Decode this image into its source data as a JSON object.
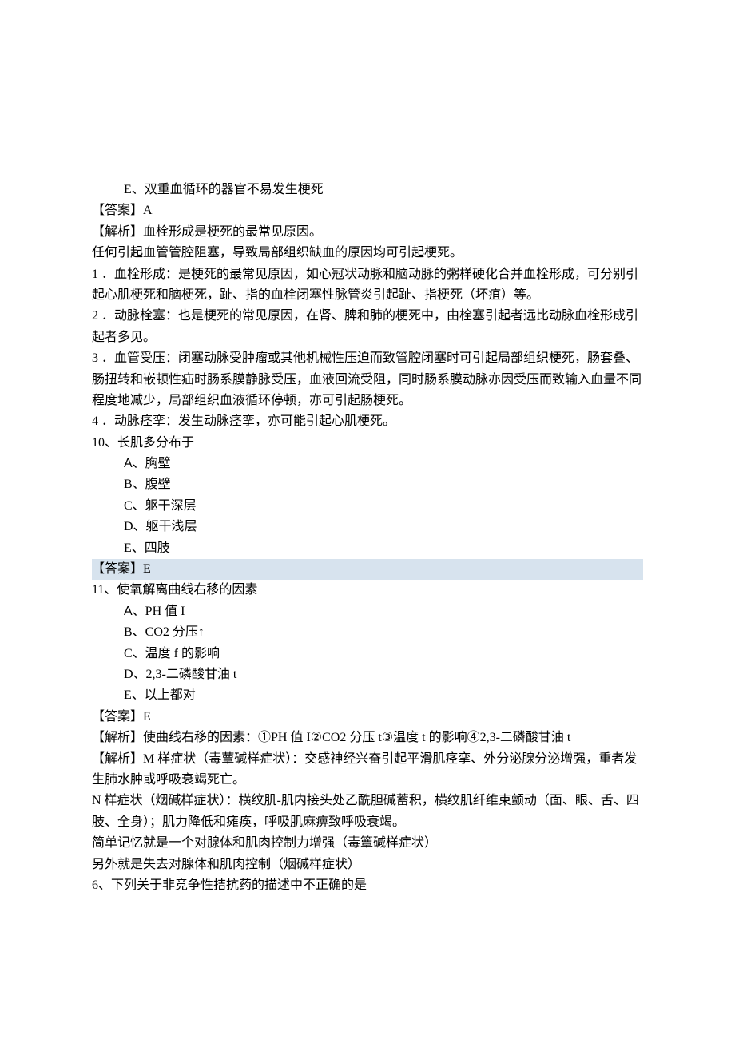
{
  "lines": {
    "l01": "E、双重血循环的器官不易发生梗死",
    "l02": "【答案】A",
    "l03": "【解析】血栓形成是梗死的最常见原因。",
    "l04": "任何引起血管管腔阻塞，导致局部组织缺血的原因均可引起梗死。",
    "l05": "1 ．血栓形成：是梗死的最常见原因，如心冠状动脉和脑动脉的粥样硬化合并血栓形成，可分别引起心肌梗死和脑梗死，趾、指的血栓闭塞性脉管炎引起趾、指梗死（坏疽）等。",
    "l06": "2 ．动脉栓塞：也是梗死的常见原因，在肾、脾和肺的梗死中，由栓塞引起者远比动脉血栓形成引起者多见。",
    "l07": "3 ．血管受压：闭塞动脉受肿瘤或其他机械性压迫而致管腔闭塞时可引起局部组织梗死，肠套叠、肠扭转和嵌顿性疝时肠系膜静脉受压，血液回流受阻，同时肠系膜动脉亦因受压而致输入血量不同程度地减少，局部组织血液循环停顿，亦可引起肠梗死。",
    "l08": "4 ．动脉痉挛：发生动脉痉挛，亦可能引起心肌梗死。",
    "q10": "10、长肌多分布于",
    "q10a_pre": "A",
    "q10a_post": "、胸壁",
    "q10b": "B、腹壁",
    "q10c": "C、躯干深层",
    "q10d": "D、躯干浅层",
    "q10e": "E、四肢",
    "a10": "【答案】E",
    "q11": "11、使氧解离曲线右移的因素",
    "q11a_pre": "A",
    "q11a_post": "、PH 值 I",
    "q11b": "B、CO2 分压↑",
    "q11c": "C、温度 f 的影响",
    "q11d": "D、2,3-二磷酸甘油 t",
    "q11e": "E、以上都对",
    "a11": "【答案】E",
    "ex11": "【解析】使曲线右移的因素：①PH 值 I②CO2 分压 t③温度 t 的影响④2,3-二磷酸甘油 t",
    "ex12a": "【解析】M 样症状（毒蕈碱样症状）：交感神经兴奋引起平滑肌痉挛、外分泌腺分泌增强，重者发生肺水肿或呼吸衰竭死亡。",
    "ex12b": "N 样症状（烟碱样症状）：横纹肌-肌内接头处乙酰胆碱蓄积，横纹肌纤维束颤动（面、眼、舌、四肢、全身）；肌力降低和瘫痪，呼吸肌麻痹致呼吸衰竭。",
    "ex12c": "简单记忆就是一个对腺体和肌肉控制力增强（毒簟碱样症状）",
    "ex12d": "另外就是失去对腺体和肌肉控制（烟碱样症状）",
    "q6": "6、下列关于非竞争性拮抗药的描述中不正确的是"
  }
}
